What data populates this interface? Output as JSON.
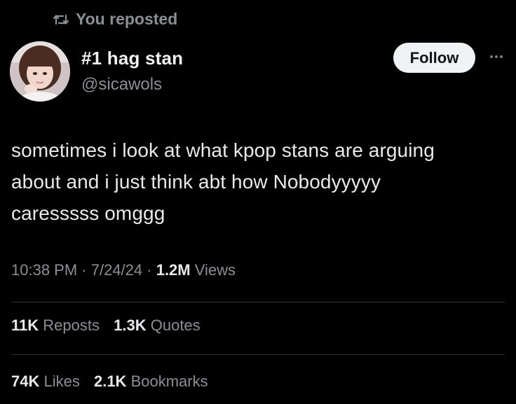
{
  "repost": {
    "icon": "repost-icon",
    "text": "You reposted"
  },
  "author": {
    "avatar": "avatar",
    "display_name": "#1 hag stan",
    "handle": "@sicawols"
  },
  "actions": {
    "follow_label": "Follow",
    "more_icon": "more-icon"
  },
  "tweet": {
    "lines": [
      "sometimes i look at what kpop stans are arguing",
      "about and i just think abt how Nobodyyyyy",
      "caresssss omggg"
    ]
  },
  "meta": {
    "time": "10:38 PM",
    "sep1": " · ",
    "date": "7/24/24",
    "sep2": " · ",
    "views_count": "1.2M",
    "views_label": " Views"
  },
  "stats": {
    "reposts_count": "11K",
    "reposts_label": "Reposts",
    "quotes_count": "1.3K",
    "quotes_label": "Quotes",
    "likes_count": "74K",
    "likes_label": "Likes",
    "bookmarks_count": "2.1K",
    "bookmarks_label": "Bookmarks"
  }
}
